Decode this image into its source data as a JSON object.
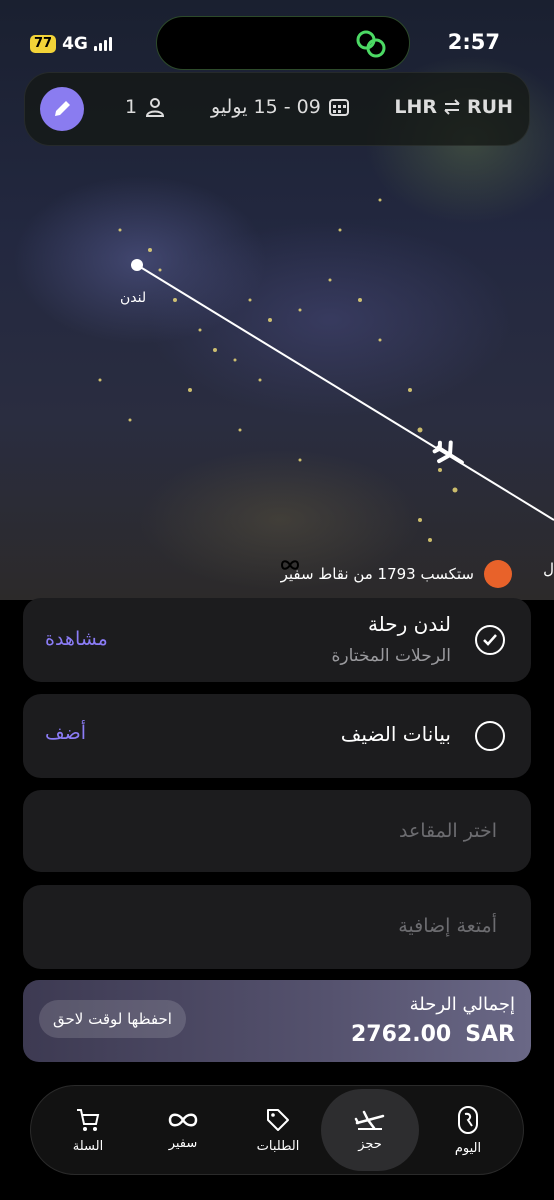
{
  "status_bar": {
    "battery": "77",
    "network": "4G",
    "time": "2:57"
  },
  "search_bar": {
    "passengers": "1",
    "dates": "09 - 15 يوليو",
    "origin": "LHR",
    "destination": "RUH"
  },
  "map": {
    "origin_label": "لندن",
    "points_text": "ستكسب 1793 من نقاط سفير",
    "edge_text": "ل"
  },
  "steps": {
    "flight": {
      "title": "لندن رحلة",
      "subtitle": "الرحلات المختارة",
      "action": "مشاهدة",
      "completed": true
    },
    "guest": {
      "title": "بيانات الضيف",
      "action": "أضف",
      "completed": false
    },
    "seats": {
      "placeholder": "اختر المقاعد"
    },
    "baggage": {
      "placeholder": "أمتعة إضافية"
    }
  },
  "total": {
    "label": "إجمالي الرحلة",
    "amount": "2762.00",
    "currency": "SAR",
    "save_label": "احفظها لوقت لاحق"
  },
  "nav": {
    "items": [
      {
        "label": "السلة",
        "icon": "cart-icon"
      },
      {
        "label": "سفير",
        "icon": "infinity-icon"
      },
      {
        "label": "الطلبات",
        "icon": "tag-icon"
      },
      {
        "label": "حجز",
        "icon": "plane-icon",
        "active": true
      },
      {
        "label": "اليوم",
        "icon": "riyadh-logo-icon"
      }
    ]
  },
  "colors": {
    "accent": "#8b7cf6",
    "card_bg": "#1c1c1e",
    "points_badge": "#e8622a"
  }
}
